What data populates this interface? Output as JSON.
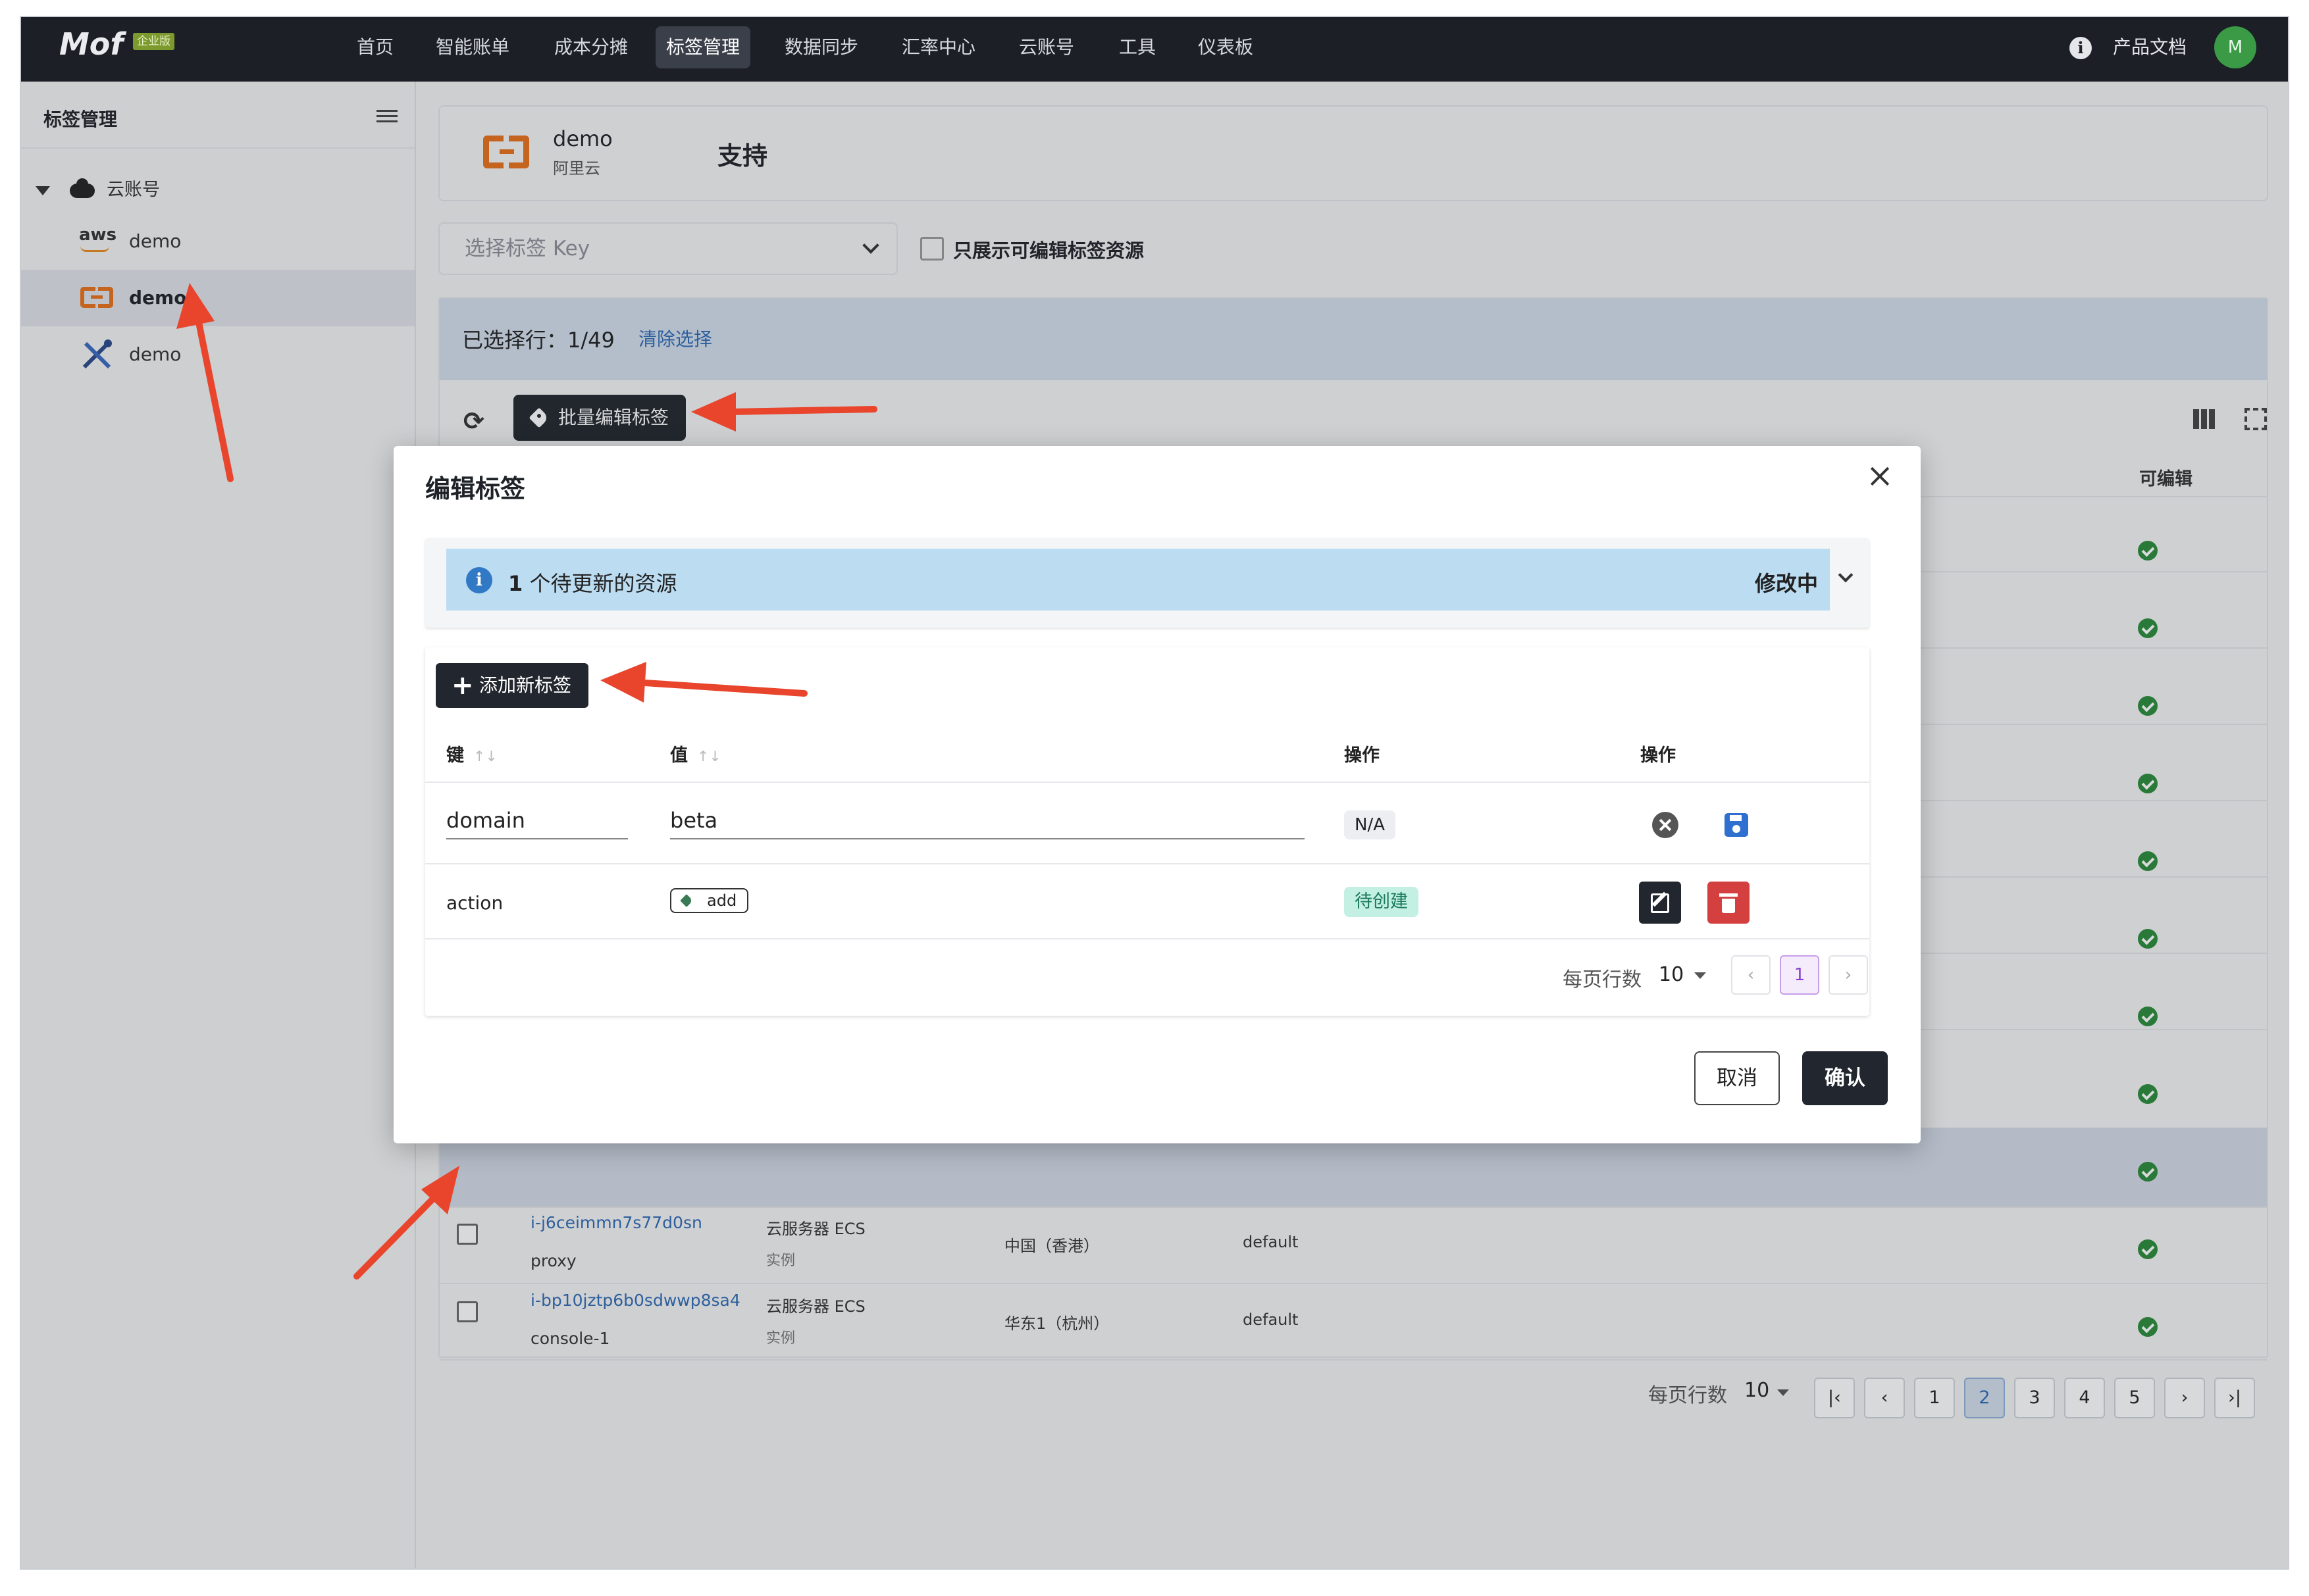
{
  "nav": {
    "brand": "Mof",
    "edition": "企业版",
    "items": [
      "首页",
      "智能账单",
      "成本分摊",
      "标签管理",
      "数据同步",
      "汇率中心",
      "云账号",
      "工具",
      "仪表板"
    ],
    "docs": "产品文档",
    "avatar": "M"
  },
  "sidebar": {
    "title": "标签管理",
    "root": "云账号",
    "accounts": [
      {
        "logo": "aws",
        "label": "demo"
      },
      {
        "logo": "aliyun",
        "label": "demo"
      },
      {
        "logo": "tools",
        "label": "demo"
      }
    ]
  },
  "provider": {
    "name": "demo",
    "vendor": "阿里云",
    "support": "支持"
  },
  "filters": {
    "tag_key_placeholder": "选择标签 Key",
    "editable_only": "只展示可编辑标签资源"
  },
  "selection": {
    "text": "已选择行：1/49",
    "clear": "清除选择"
  },
  "toolbar": {
    "bulk_edit": "批量编辑标签"
  },
  "table": {
    "editable_header": "可编辑",
    "rows": [
      {
        "id": "i-j6ceimmn7s77d0sn",
        "name": "proxy",
        "type": "云服务器 ECS",
        "subtype": "实例",
        "region": "中国（香港）",
        "project": "default"
      },
      {
        "id": "i-bp10jztp6b0sdwwp8sa4",
        "name": "console-1",
        "type": "云服务器 ECS",
        "subtype": "实例",
        "region": "华东1（杭州）",
        "project": "default"
      }
    ],
    "pagination": {
      "rows_label": "每页行数",
      "rows_value": "10",
      "pages": [
        "1",
        "2",
        "3",
        "4",
        "5"
      ],
      "current": "2"
    }
  },
  "modal": {
    "title": "编辑标签",
    "count": "1",
    "count_text": "个待更新的资源",
    "status": "修改中",
    "add_button": "添加新标签",
    "headers": {
      "key": "键",
      "value": "值",
      "op1": "操作",
      "op2": "操作"
    },
    "rows": [
      {
        "key": "domain",
        "value": "beta",
        "state": "N/A"
      },
      {
        "key": "action",
        "value": "add",
        "state": "待创建"
      }
    ],
    "pagination": {
      "rows_label": "每页行数",
      "rows_value": "10",
      "current": "1"
    },
    "cancel": "取消",
    "confirm": "确认"
  },
  "colors": {
    "accent_dark": "#22262e",
    "aliyun_orange": "#e8711a",
    "annotation_red": "#e8452c",
    "ok_green": "#2a8a3a",
    "link_blue": "#2f6bb5"
  }
}
